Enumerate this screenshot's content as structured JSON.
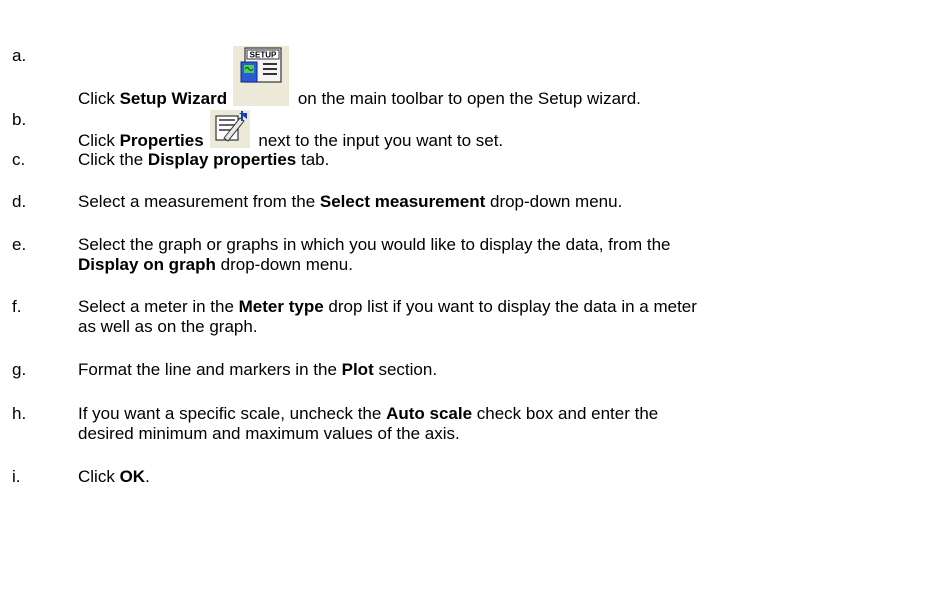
{
  "steps": [
    {
      "letter": "a.",
      "before": "Click ",
      "bold": "Setup Wizard",
      "after": " on the main toolbar to open the Setup wizard.",
      "icon": "setup-wizard-icon"
    },
    {
      "letter": "b.",
      "before": "Click ",
      "bold": "Properties",
      "after": " next to the input you want to set.",
      "icon": "properties-icon"
    },
    {
      "letter": "c.",
      "before": "Click the ",
      "bold": "Display properties",
      "after": " tab."
    },
    {
      "letter": "d.",
      "before": "Select a measurement from the ",
      "bold": "Select measurement",
      "after": " drop-down menu."
    },
    {
      "letter": "e.",
      "line1": "Select the graph or graphs in which you would like to display the data, from the",
      "bold": "Display on graph",
      "after": " drop-down menu."
    },
    {
      "letter": "f.",
      "before": "Select a meter in the ",
      "bold": "Meter type",
      "after": " drop list if you want to display the data in a meter",
      "line2": "as well as on the graph."
    },
    {
      "letter": "g.",
      "before": "Format the line and markers in the ",
      "bold": "Plot",
      "after": " section."
    },
    {
      "letter": "h.",
      "before": "If you want a specific scale, uncheck the ",
      "bold": "Auto scale",
      "after": " check box and enter the",
      "line2": "desired minimum and maximum values of the axis."
    },
    {
      "letter": "i.",
      "before": "Click ",
      "bold": "OK",
      "after": "."
    }
  ],
  "icons": {
    "setup_text": "SETUP"
  }
}
